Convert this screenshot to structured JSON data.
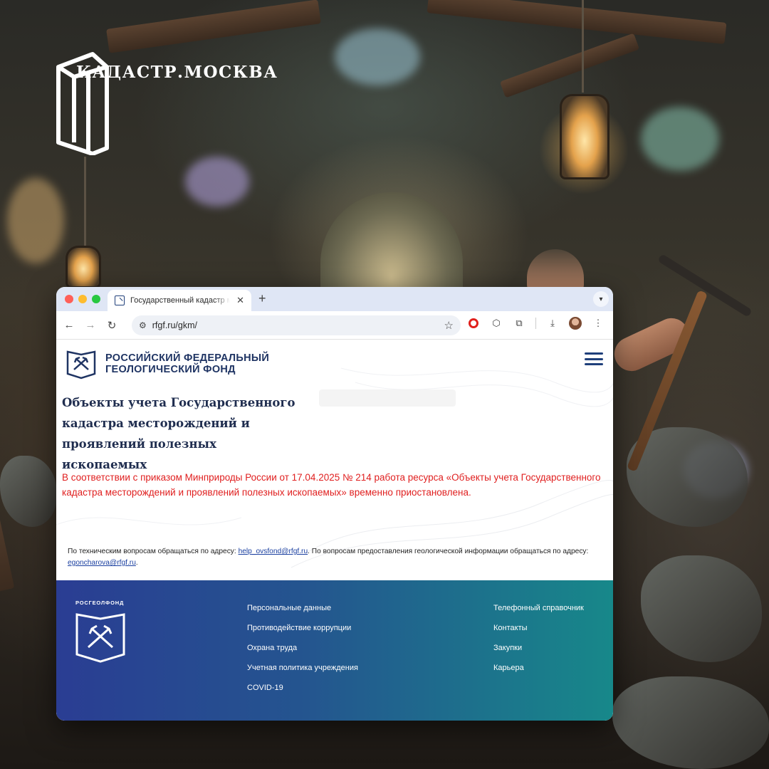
{
  "brand": {
    "name": "КАДАСТР.МОСКВА"
  },
  "browser": {
    "tab_title": "Государственный кадастр м",
    "url": "rfgf.ru/gkm/"
  },
  "site": {
    "org_name_line1": "РОССИЙСКИЙ ФЕДЕРАЛЬНЫЙ",
    "org_name_line2": "ГЕОЛОГИЧЕСКИЙ ФОНД",
    "title": "Объекты учета Государственного кадастра месторождений и проявлений полезных ископаемых",
    "notice": "В соответствии с приказом Минприроды России от 17.04.2025 №  214 работа ресурса «Объекты учета Государственного кадастра месторождений и проявлений полезных ископаемых» временно приостановлена.",
    "contact": {
      "text1": "По техническим вопросам обращаться по адресу: ",
      "email1": "help_ovsfond@rfgf.ru",
      "text2": ". По вопросам предоставления геологической информации обращаться по адресу: ",
      "email2": "egoncharova@rfgf.ru",
      "text3": "."
    }
  },
  "footer": {
    "brand_label": "РОСГЕОЛФОНД",
    "col1": [
      "Персональные данные",
      "Противодействие коррупции",
      "Охрана труда",
      "Учетная политика учреждения",
      "COVID-19"
    ],
    "col2": [
      "Телефонный справочник",
      "Контакты",
      "Закупки",
      "Карьера"
    ]
  },
  "colors": {
    "accent": "#1f3f7a",
    "notice": "#e02020",
    "footer_start": "#2a3d93",
    "footer_end": "#17888a"
  }
}
